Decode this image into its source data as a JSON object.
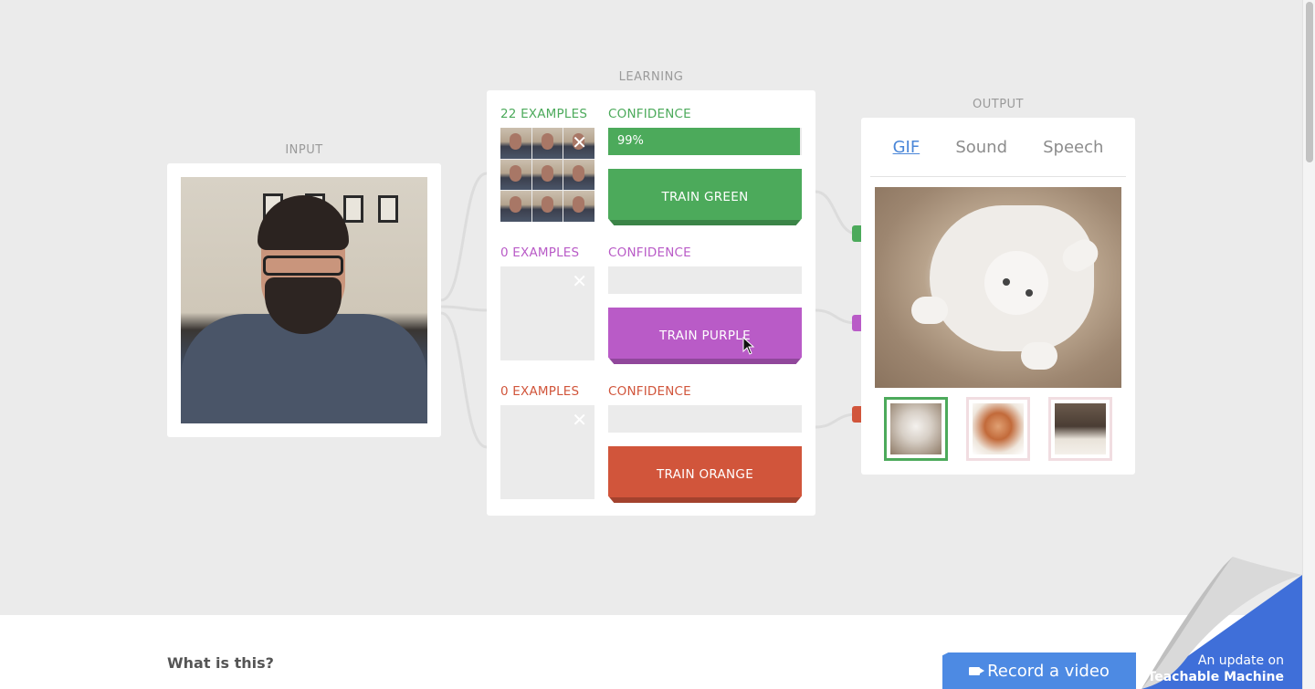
{
  "sections": {
    "input": "INPUT",
    "learning": "LEARNING",
    "output": "OUTPUT"
  },
  "classes": [
    {
      "examples": "22 EXAMPLES",
      "confidence_label": "CONFIDENCE",
      "confidence_value": "99%",
      "confidence_fraction": 0.99,
      "button": "TRAIN GREEN",
      "color": "#4caa5b",
      "has_examples": true
    },
    {
      "examples": "0 EXAMPLES",
      "confidence_label": "CONFIDENCE",
      "confidence_value": "",
      "confidence_fraction": 0,
      "button": "TRAIN PURPLE",
      "color": "#b95bc7",
      "has_examples": false
    },
    {
      "examples": "0 EXAMPLES",
      "confidence_label": "CONFIDENCE",
      "confidence_value": "",
      "confidence_fraction": 0,
      "button": "TRAIN ORANGE",
      "color": "#d1553b",
      "has_examples": false
    }
  ],
  "output": {
    "tabs": [
      "GIF",
      "Sound",
      "Speech"
    ],
    "active_tab": "GIF",
    "selected_gif_index": 0
  },
  "bottom": {
    "what_is_this": "What is this?",
    "record_button": "Record a video",
    "record_button_color": "#4d8ae3"
  },
  "peel": {
    "line1": "An update on",
    "line2": "Teachable Machine",
    "color": "#3f6fd9"
  }
}
